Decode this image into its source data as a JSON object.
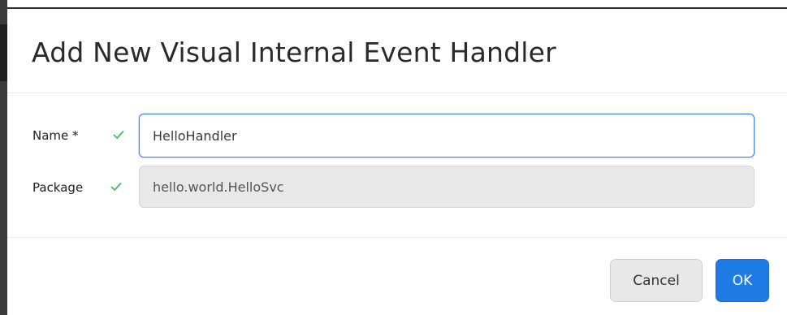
{
  "dialog": {
    "title": "Add New Visual Internal Event Handler"
  },
  "form": {
    "name": {
      "label": "Name *",
      "value": "HelloHandler",
      "valid_icon": "check-icon"
    },
    "package": {
      "label": "Package",
      "value": "hello.world.HelloSvc",
      "valid_icon": "check-icon",
      "readonly": true
    }
  },
  "footer": {
    "cancel_label": "Cancel",
    "ok_label": "OK"
  },
  "colors": {
    "accent": "#1f7be6",
    "focus_border": "#3f83f8",
    "valid_check": "#3cc063",
    "readonly_bg": "#e9e9e9"
  }
}
